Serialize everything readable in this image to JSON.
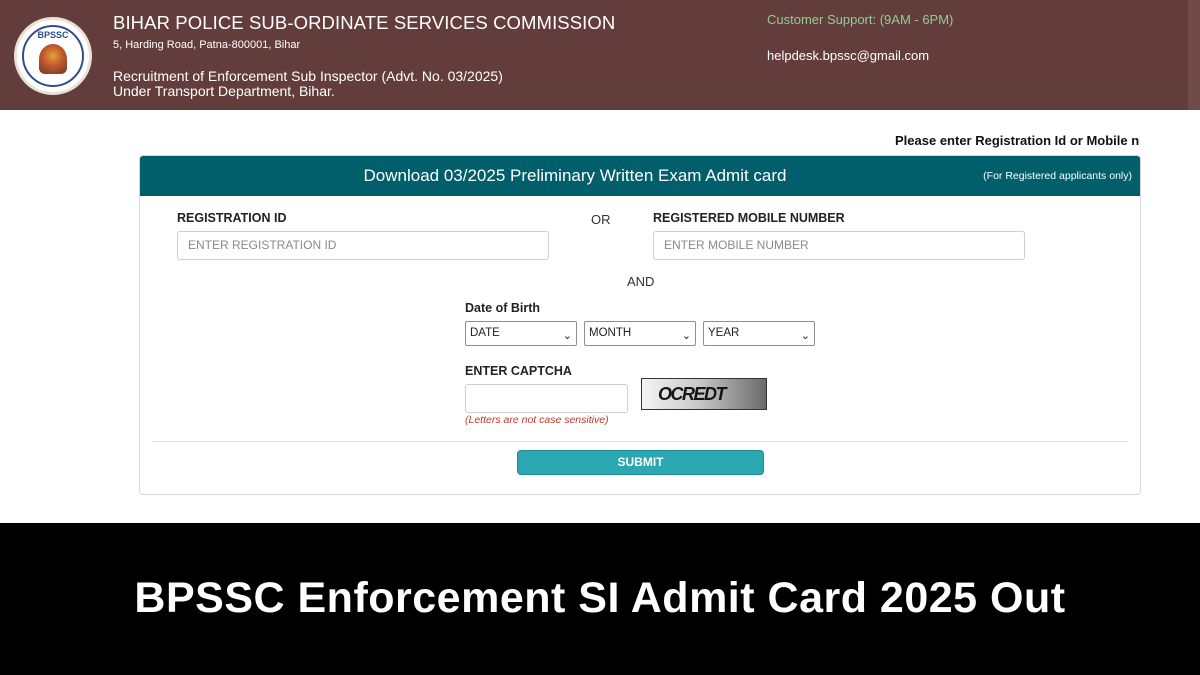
{
  "header": {
    "logo_text": "BPSSC",
    "org_title": "BIHAR POLICE SUB-ORDINATE SERVICES COMMISSION",
    "address": "5, Harding Road, Patna-800001, Bihar",
    "recruitment_line1": "Recruitment of Enforcement Sub Inspector (Advt. No. 03/2025)",
    "recruitment_line2": "Under Transport Department, Bihar.",
    "support": "Customer Support: (9AM - 6PM)",
    "helpdesk_email": "helpdesk.bpssc@gmail.com"
  },
  "notice": "Please enter Registration Id or Mobile nu",
  "card": {
    "title": "Download 03/2025 Preliminary Written Exam Admit card",
    "subtitle": "(For Registered applicants only)",
    "reg_label": "REGISTRATION ID",
    "reg_placeholder": "ENTER REGISTRATION ID",
    "or_text": "OR",
    "mobile_label": "REGISTERED MOBILE NUMBER",
    "mobile_placeholder": "ENTER MOBILE NUMBER",
    "and_text": "AND",
    "dob_label": "Date of Birth",
    "date_select": "DATE",
    "month_select": "MONTH",
    "year_select": "YEAR",
    "captcha_label": "ENTER CAPTCHA",
    "captcha_value": "OCREDT",
    "captcha_hint": "(Letters are not case sensitive)",
    "submit_label": "SUBMIT"
  },
  "banner": {
    "headline": "BPSSC Enforcement SI Admit Card 2025 Out"
  },
  "colors": {
    "header_bg": "#633d3c",
    "card_header_bg": "#005f6b",
    "submit_bg": "#2aa7b0",
    "support_text": "#8fcf8f",
    "hint_text": "#c0392b"
  }
}
